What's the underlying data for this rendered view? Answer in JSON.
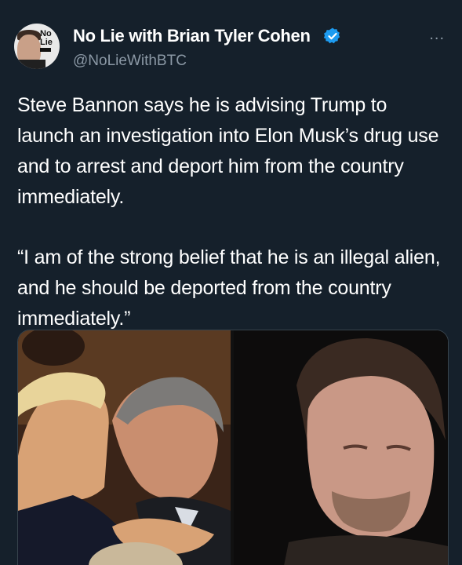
{
  "author": {
    "display_name": "No Lie with Brian Tyler Cohen",
    "handle": "@NoLieWithBTC",
    "avatar_logo": [
      "No",
      "Lie"
    ],
    "verified": true
  },
  "more_label": "...",
  "tweet": {
    "paragraphs": [
      "Steve Bannon says he is advising Trump to launch an investigation into Elon Musk’s drug use and to arrest and deport him from the country immediately.",
      "“I am of the strong belief that he is an illegal alien, and he should be deported from the country immediately.”"
    ]
  },
  "media": {
    "images": [
      {
        "icon": "photo-trump-bannon"
      },
      {
        "icon": "photo-elon-musk"
      }
    ]
  },
  "colors": {
    "background": "#15202b",
    "text": "#ffffff",
    "secondary_text": "#8b98a5",
    "verified_badge": "#1d9bf0",
    "media_border": "#38444d"
  }
}
